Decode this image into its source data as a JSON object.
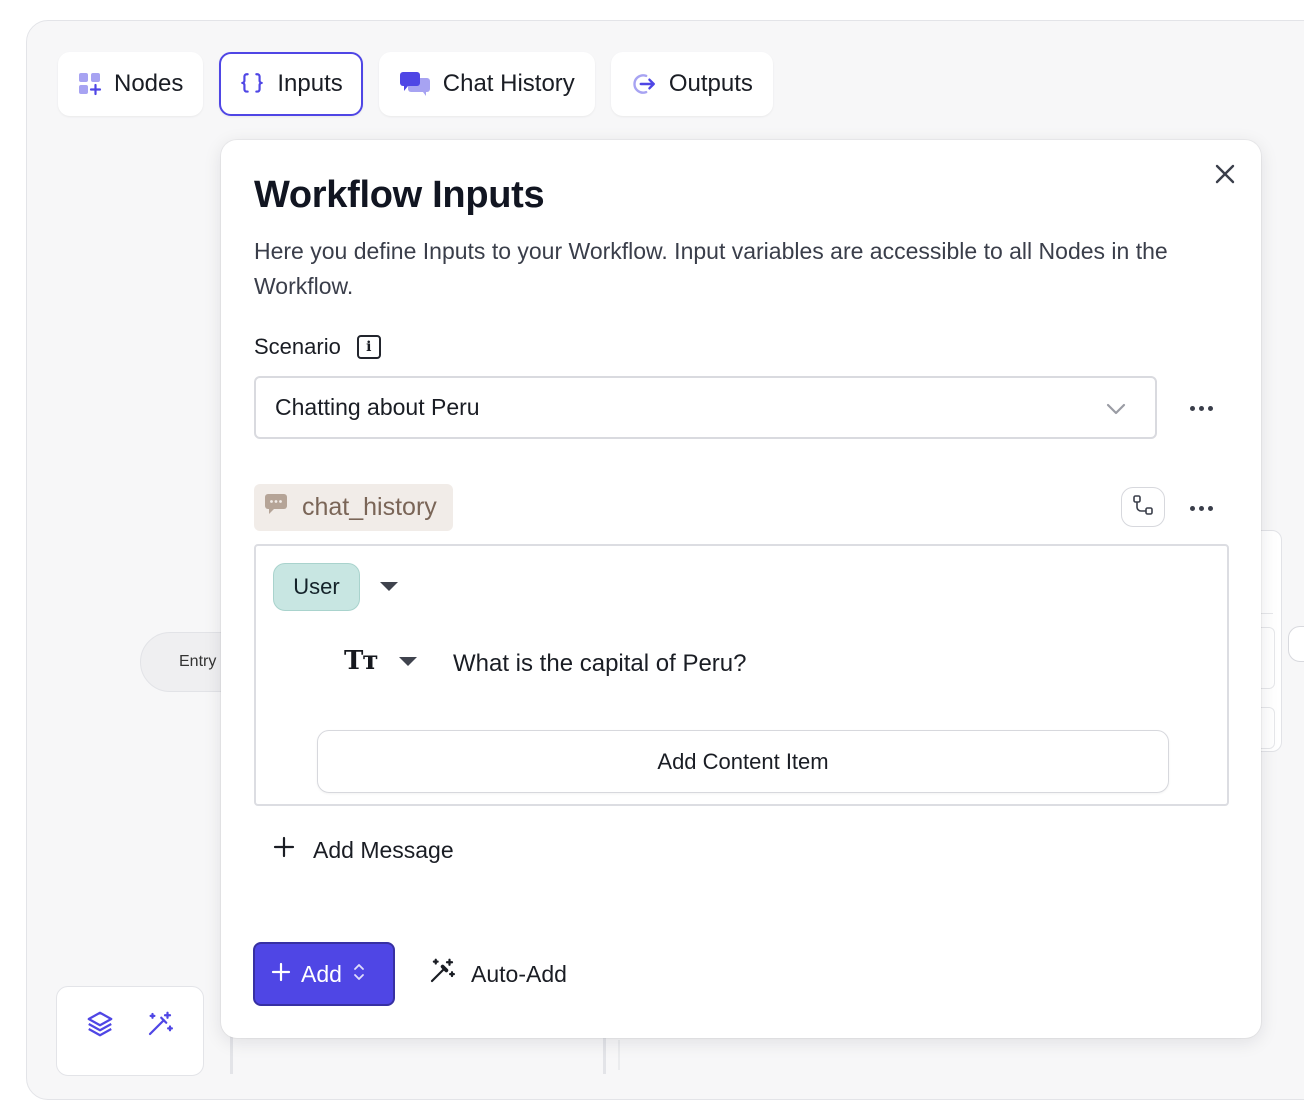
{
  "tabs": [
    {
      "label": "Nodes",
      "icon": "nodes-plus-icon",
      "active": false
    },
    {
      "label": "Inputs",
      "icon": "curly-braces-icon",
      "active": true
    },
    {
      "label": "Chat History",
      "icon": "chat-bubbles-icon",
      "active": false
    },
    {
      "label": "Outputs",
      "icon": "arrow-out-icon",
      "active": false
    }
  ],
  "background": {
    "entry_label": "Entry"
  },
  "panel": {
    "title": "Workflow Inputs",
    "description": "Here you define Inputs to your Workflow. Input variables are accessible to all Nodes in the Workflow.",
    "scenario_label": "Scenario",
    "scenario_value": "Chatting about Peru",
    "variable_name": "chat_history",
    "message": {
      "role": "User",
      "content_type_label": "Tт",
      "content_text": "What is the capital of Peru?"
    },
    "add_content_item_label": "Add Content Item",
    "add_message_label": "Add Message",
    "add_button_label": "Add",
    "auto_add_label": "Auto-Add"
  },
  "colors": {
    "accent": "#4f46e5",
    "role_chip": "#c8e6e2",
    "variable_chip": "#f1ece8"
  }
}
